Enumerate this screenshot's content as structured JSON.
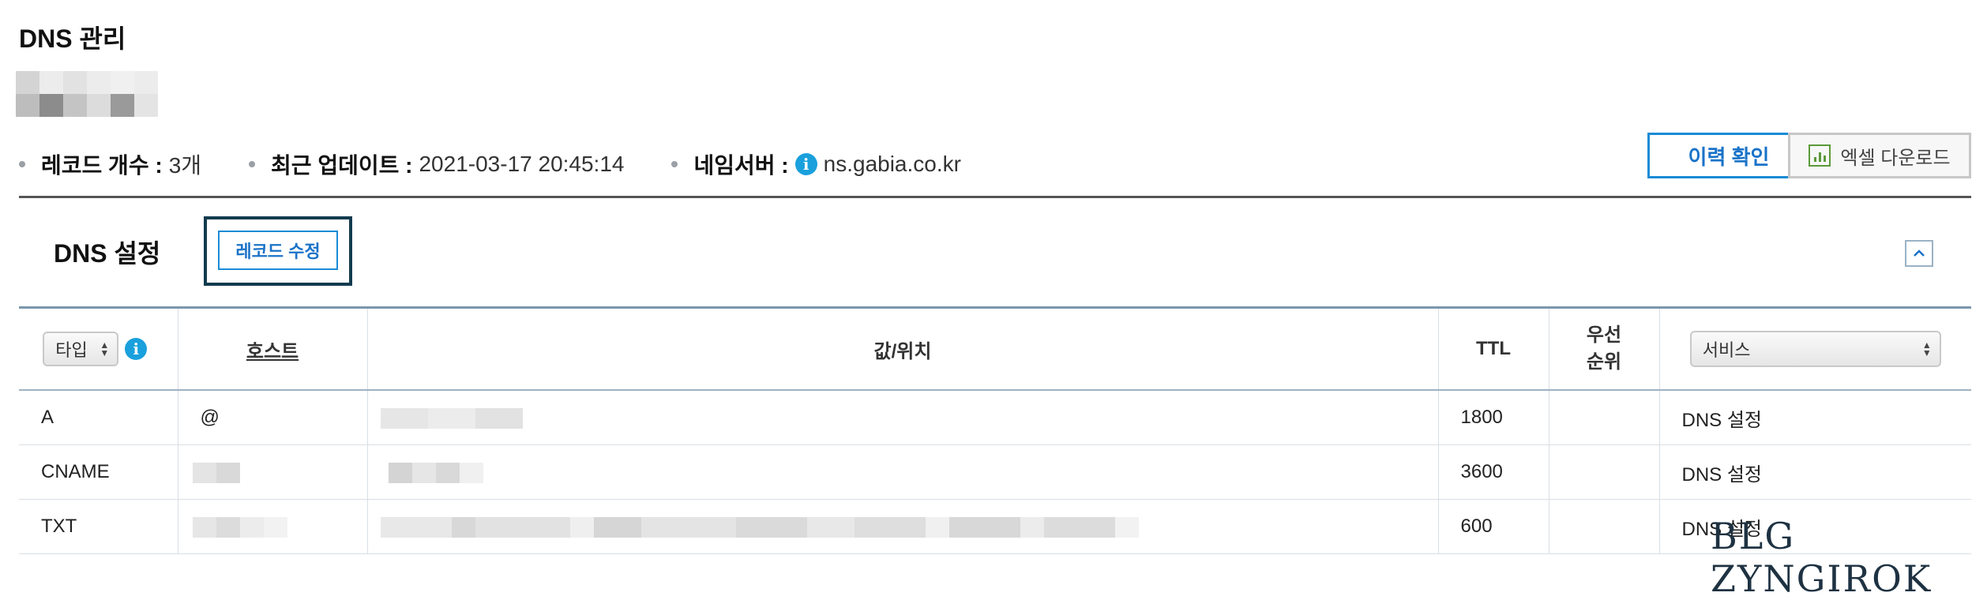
{
  "page": {
    "title": "DNS 관리"
  },
  "meta": {
    "record_count_label": "레코드 개수 :",
    "record_count_value": "3개",
    "last_update_label": "최근 업데이트 :",
    "last_update_value": "2021-03-17 20:45:14",
    "nameserver_label": "네임서버 :",
    "nameserver_value": "ns.gabia.co.kr"
  },
  "actions": {
    "history_label": "이력 확인",
    "excel_label": "엑셀 다운로드"
  },
  "section": {
    "title": "DNS 설정",
    "record_edit_label": "레코드 수정",
    "collapse_icon": "^"
  },
  "table": {
    "type_select_value": "타입",
    "headers": {
      "host": "호스트",
      "value": "값/위치",
      "ttl": "TTL",
      "priority_line1": "우선",
      "priority_line2": "순위"
    },
    "service_select_value": "서비스",
    "rows": [
      {
        "type": "A",
        "host": "@",
        "ttl": "1800",
        "priority": "",
        "service": "DNS 설정"
      },
      {
        "type": "CNAME",
        "host": "",
        "ttl": "3600",
        "priority": "",
        "service": "DNS 설정"
      },
      {
        "type": "TXT",
        "host": "",
        "ttl": "600",
        "priority": "",
        "service": "DNS 설정"
      }
    ]
  },
  "watermark": "BLG ZYNGIROK",
  "colors": {
    "accent_blue": "#1a8bd6",
    "info_icon": "#1aa0dc",
    "excel_green": "#5b9a3a",
    "frame_dark": "#123b4f"
  },
  "icons": {
    "info": "info-icon",
    "excel": "bar-chart-icon",
    "collapse": "chevron-up-icon",
    "select": "updown-arrows-icon"
  }
}
